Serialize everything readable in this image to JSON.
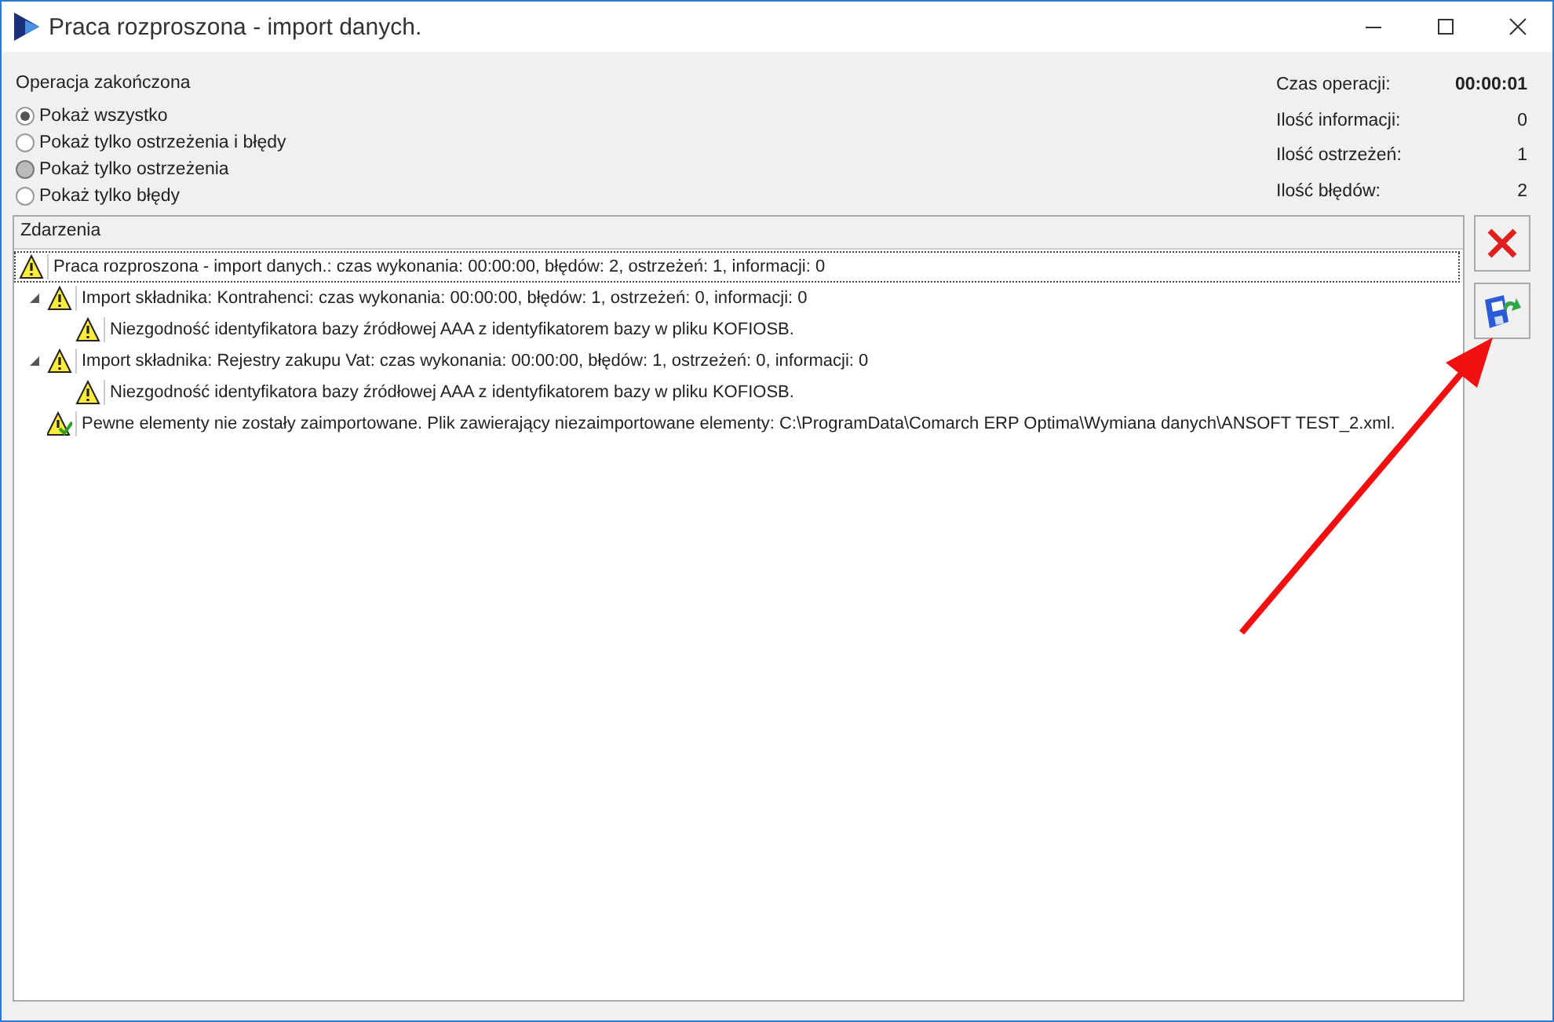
{
  "window": {
    "title": "Praca rozproszona - import danych."
  },
  "status": {
    "label": "Operacja zakończona"
  },
  "filters": [
    {
      "label": "Pokaż wszystko",
      "selected": true,
      "highlighted": false
    },
    {
      "label": "Pokaż tylko ostrzeżenia i błędy",
      "selected": false,
      "highlighted": false
    },
    {
      "label": "Pokaż tylko ostrzeżenia",
      "selected": false,
      "highlighted": true
    },
    {
      "label": "Pokaż tylko błędy",
      "selected": false,
      "highlighted": false
    }
  ],
  "stats": [
    {
      "label": "Czas operacji:",
      "value": "00:00:01",
      "bold": true
    },
    {
      "label": "Ilość informacji:",
      "value": "0",
      "bold": false
    },
    {
      "label": "Ilość ostrzeżeń:",
      "value": "1",
      "bold": false
    },
    {
      "label": "Ilość błędów:",
      "value": "2",
      "bold": false
    }
  ],
  "events": {
    "header": "Zdarzenia",
    "rows": [
      {
        "kind": "warning",
        "text": "Praca rozproszona - import danych.: czas wykonania: 00:00:00, błędów: 2, ostrzeżeń: 1, informacji: 0",
        "selected": true,
        "children": [
          {
            "kind": "warning",
            "text": "Import składnika: Kontrahenci: czas wykonania: 00:00:00, błędów: 1, ostrzeżeń: 0, informacji: 0",
            "selected": false,
            "expanded": true,
            "children": [
              {
                "kind": "warning",
                "text": "Niezgodność identyfikatora bazy źródłowej AAA z identyfikatorem bazy w pliku KOFIOSB.",
                "selected": false
              }
            ]
          },
          {
            "kind": "warning",
            "text": "Import składnika: Rejestry zakupu Vat: czas wykonania: 00:00:00, błędów: 1, ostrzeżeń: 0, informacji: 0",
            "selected": false,
            "expanded": true,
            "children": [
              {
                "kind": "warning",
                "text": "Niezgodność identyfikatora bazy źródłowej AAA z identyfikatorem bazy w pliku KOFIOSB.",
                "selected": false
              }
            ]
          },
          {
            "kind": "partial",
            "text": "Pewne elementy nie zostały zaimportowane. Plik zawierający niezaimportowane elementy: C:\\ProgramData\\Comarch ERP Optima\\Wymiana danych\\ANSOFT TEST_2.xml.",
            "selected": false
          }
        ]
      }
    ]
  },
  "actions": [
    {
      "kind": "cancel"
    },
    {
      "kind": "save"
    }
  ]
}
